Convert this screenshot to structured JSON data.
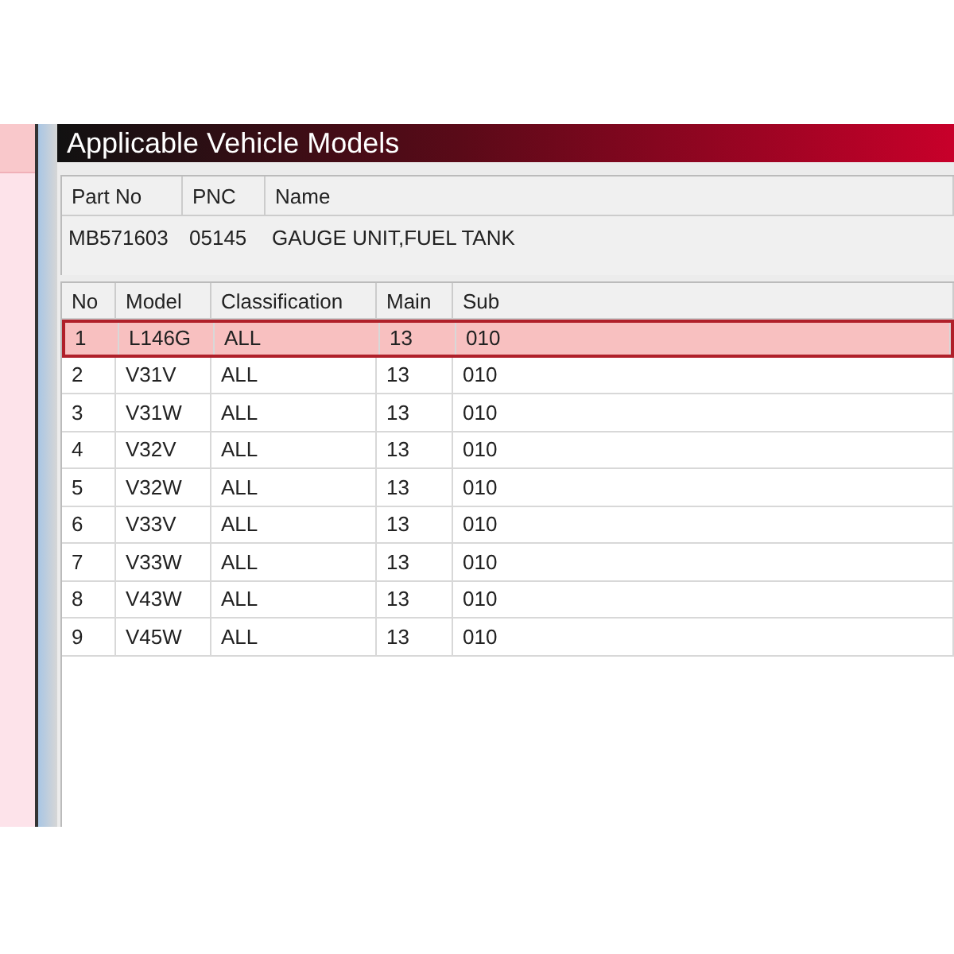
{
  "window": {
    "title": "Applicable Vehicle Models"
  },
  "part": {
    "columns": [
      "Part No",
      "PNC",
      "Name"
    ],
    "values": [
      "MB571603",
      "05145",
      "GAUGE UNIT,FUEL TANK"
    ]
  },
  "table": {
    "columns": [
      "No",
      "Model",
      "Classification",
      "Main",
      "Sub"
    ],
    "rows": [
      {
        "cells": [
          "1",
          "L146G",
          "ALL",
          "13",
          "010"
        ],
        "selected": true
      },
      {
        "cells": [
          "2",
          "V31V",
          "ALL",
          "13",
          "010"
        ],
        "selected": false
      },
      {
        "cells": [
          "3",
          "V31W",
          "ALL",
          "13",
          "010"
        ],
        "selected": false
      },
      {
        "cells": [
          "4",
          "V32V",
          "ALL",
          "13",
          "010"
        ],
        "selected": false
      },
      {
        "cells": [
          "5",
          "V32W",
          "ALL",
          "13",
          "010"
        ],
        "selected": false
      },
      {
        "cells": [
          "6",
          "V33V",
          "ALL",
          "13",
          "010"
        ],
        "selected": false
      },
      {
        "cells": [
          "7",
          "V33W",
          "ALL",
          "13",
          "010"
        ],
        "selected": false
      },
      {
        "cells": [
          "8",
          "V43W",
          "ALL",
          "13",
          "010"
        ],
        "selected": false
      },
      {
        "cells": [
          "9",
          "V45W",
          "ALL",
          "13",
          "010"
        ],
        "selected": false
      }
    ]
  }
}
